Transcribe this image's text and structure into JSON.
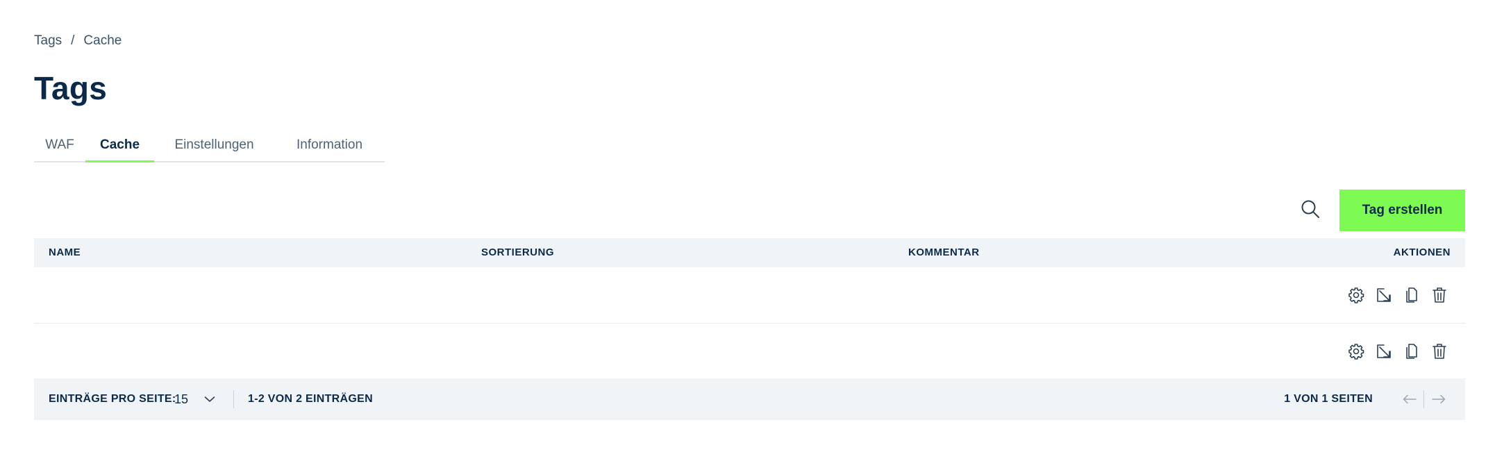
{
  "breadcrumb": {
    "items": [
      "Tags",
      "Cache"
    ],
    "separator": "/"
  },
  "page": {
    "title": "Tags"
  },
  "tabs": [
    {
      "label": "WAF",
      "active": false
    },
    {
      "label": "Cache",
      "active": true
    },
    {
      "label": "Einstellungen",
      "active": false
    },
    {
      "label": "Information",
      "active": false
    }
  ],
  "toolbar": {
    "search_icon": "search-icon",
    "create_label": "Tag erstellen"
  },
  "table": {
    "columns": [
      "NAME",
      "SORTIERUNG",
      "KOMMENTAR",
      "AKTIONEN"
    ],
    "rows": [
      {
        "name": "",
        "sort": "",
        "comment": "",
        "actions": [
          "gear-icon",
          "open-external-icon",
          "copy-icon",
          "trash-icon"
        ]
      },
      {
        "name": "",
        "sort": "",
        "comment": "",
        "actions": [
          "gear-icon",
          "open-external-icon",
          "copy-icon",
          "trash-icon"
        ]
      }
    ]
  },
  "pagination": {
    "per_page_label": "EINTRÄGE PRO SEITE:",
    "per_page_value": "15",
    "entries_info": "1-2 VON 2 EINTRÄGEN",
    "pages_info": "1 VON 1 SEITEN"
  },
  "colors": {
    "accent": "#7dfb53",
    "text": "#0b2a4a",
    "header_bg": "#f1f4f7"
  }
}
